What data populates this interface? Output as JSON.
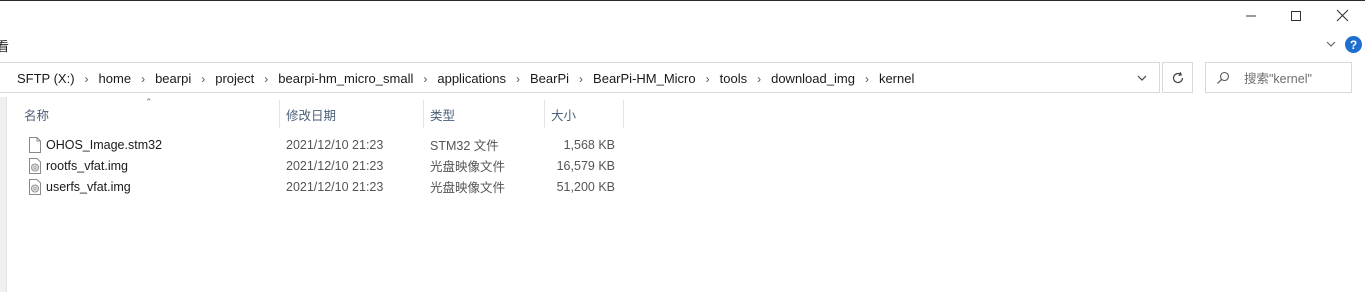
{
  "window": {
    "controls": [
      {
        "name": "minimize-icon",
        "glyph": "minimize"
      },
      {
        "name": "maximize-icon",
        "glyph": "maximize"
      },
      {
        "name": "close-icon",
        "glyph": "close"
      }
    ]
  },
  "ribbon": {
    "left_fragment": "看",
    "help_label": "?"
  },
  "address_bar": {
    "breadcrumbs": [
      "SFTP (X:)",
      "home",
      "bearpi",
      "project",
      "bearpi-hm_micro_small",
      "applications",
      "BearPi",
      "BearPi-HM_Micro",
      "tools",
      "download_img",
      "kernel"
    ]
  },
  "search": {
    "placeholder": "搜索\"kernel\""
  },
  "columns": {
    "name": "名称",
    "date": "修改日期",
    "type": "类型",
    "size": "大小"
  },
  "files": [
    {
      "name": "OHOS_Image.stm32",
      "date": "2021/12/10 21:23",
      "type": "STM32 文件",
      "size": "1,568 KB",
      "icon": "file-icon"
    },
    {
      "name": "rootfs_vfat.img",
      "date": "2021/12/10 21:23",
      "type": "光盘映像文件",
      "size": "16,579 KB",
      "icon": "disc-image-icon"
    },
    {
      "name": "userfs_vfat.img",
      "date": "2021/12/10 21:23",
      "type": "光盘映像文件",
      "size": "51,200 KB",
      "icon": "disc-image-icon"
    }
  ],
  "colors": {
    "header_text": "#4c607a",
    "help_blue": "#1f6fd1",
    "border": "#d9d9d9"
  }
}
